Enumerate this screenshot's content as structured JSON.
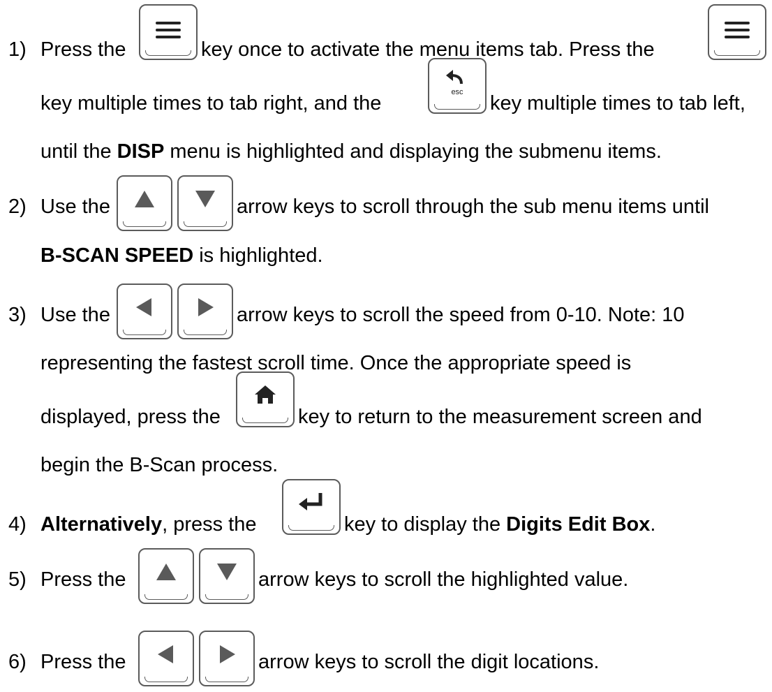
{
  "steps": [
    {
      "num": "1)",
      "l1a": "Press the",
      "l1b": "key once to activate the menu items tab.  Press the",
      "l2a": "key multiple times to tab right, and the",
      "l2b": "key multiple times to tab left,",
      "l3a": "until the",
      "l3b": "DISP",
      "l3c": "menu is highlighted and displaying the submenu items."
    },
    {
      "num": "2)",
      "l1a": "Use the",
      "l1b": "arrow keys to scroll through the sub menu items until",
      "l2a": "B-SCAN SPEED",
      "l2b": "is highlighted."
    },
    {
      "num": "3)",
      "l1a": "Use the",
      "l1b": "arrow keys to scroll the speed from 0-10.  Note:  10",
      "l2a": "representing the fastest scroll time.  Once the appropriate speed is",
      "l3a": "displayed, press the",
      "l3b": "key to return to the measurement screen and",
      "l4a": "begin the B-Scan process."
    },
    {
      "num": "4)",
      "l1a": "Alternatively",
      "l1b": ", press the",
      "l1c": "key to display the",
      "l1d": "Digits Edit Box",
      "l1e": "."
    },
    {
      "num": "5)",
      "l1a": "Press the",
      "l1b": "arrow keys to scroll the highlighted value."
    },
    {
      "num": "6)",
      "l1a": "Press the",
      "l1b": "arrow keys to scroll the digit locations."
    }
  ],
  "keys": {
    "menu": "menu-key",
    "escape": "esc",
    "up": "up-arrow-key",
    "down": "down-arrow-key",
    "left": "left-arrow-key",
    "right": "right-arrow-key",
    "home": "home-key",
    "enter": "enter-key"
  }
}
